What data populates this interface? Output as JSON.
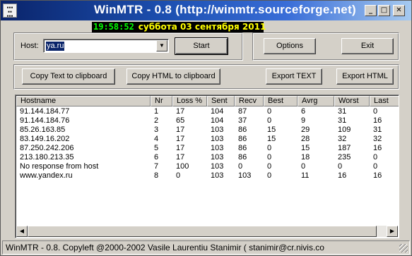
{
  "window": {
    "title": "WinMTR - 0.8 (http://winmtr.sourceforge.net)",
    "icon_text": "0000\n00\n000",
    "minimize": "_",
    "maximize": "□",
    "close": "✕"
  },
  "clock": {
    "time": "19:58:52",
    "date": "суббота 03 сентября 2011"
  },
  "host": {
    "label": "Host:",
    "value": "ya.ru",
    "arrow": "▼"
  },
  "buttons": {
    "start": "Start",
    "options": "Options",
    "exit": "Exit",
    "copy_text": "Copy Text to clipboard",
    "copy_html": "Copy HTML to clipboard",
    "export_text": "Export TEXT",
    "export_html": "Export HTML"
  },
  "table": {
    "columns": [
      "Hostname",
      "Nr",
      "Loss %",
      "Sent",
      "Recv",
      "Best",
      "Avrg",
      "Worst",
      "Last"
    ],
    "rows": [
      [
        "91.144.184.77",
        "1",
        "17",
        "104",
        "87",
        "0",
        "6",
        "31",
        "0"
      ],
      [
        "91.144.184.76",
        "2",
        "65",
        "104",
        "37",
        "0",
        "9",
        "31",
        "16"
      ],
      [
        "85.26.163.85",
        "3",
        "17",
        "103",
        "86",
        "15",
        "29",
        "109",
        "31"
      ],
      [
        "83.149.16.202",
        "4",
        "17",
        "103",
        "86",
        "15",
        "28",
        "32",
        "32"
      ],
      [
        "87.250.242.206",
        "5",
        "17",
        "103",
        "86",
        "0",
        "15",
        "187",
        "16"
      ],
      [
        "213.180.213.35",
        "6",
        "17",
        "103",
        "86",
        "0",
        "18",
        "235",
        "0"
      ],
      [
        "No response from host",
        "7",
        "100",
        "103",
        "0",
        "0",
        "0",
        "0",
        "0"
      ],
      [
        "www.yandex.ru",
        "8",
        "0",
        "103",
        "103",
        "0",
        "11",
        "16",
        "16"
      ]
    ]
  },
  "scrollbar": {
    "left": "◀",
    "right": "▶"
  },
  "status": {
    "text": "WinMTR - 0.8. Copyleft @2000-2002 Vasile Laurentiu Stanimir  ( stanimir@cr.nivis.co"
  }
}
